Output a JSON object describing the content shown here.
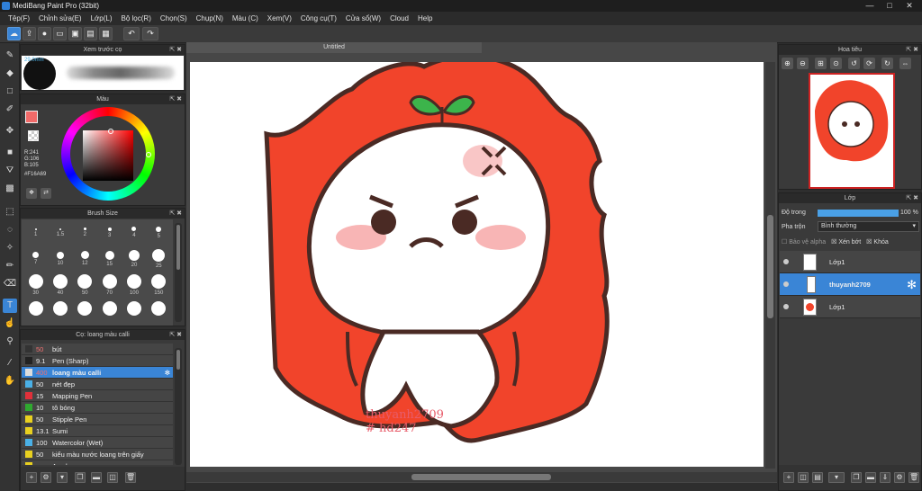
{
  "title": "MediBang Paint Pro (32bit)",
  "window_controls": {
    "minimize": "—",
    "maximize": "□",
    "close": "✕"
  },
  "menu": [
    "Tệp(F)",
    "Chỉnh sửa(E)",
    "Lớp(L)",
    "Bộ lọc(R)",
    "Chọn(S)",
    "Chụp(N)",
    "Màu (C)",
    "Xem(V)",
    "Công cụ(T)",
    "Cửa sổ(W)",
    "Cloud",
    "Help"
  ],
  "toolbar_icons": [
    "cloud-icon",
    "export-icon",
    "speech-icon",
    "comment-icon",
    "save-icon",
    "layout-icon",
    "grid-icon",
    "undo-icon",
    "redo-icon"
  ],
  "left_tools": [
    "brush-icon",
    "eraser-icon",
    "rectangle-icon",
    "pen-fill-icon",
    "move-icon",
    "fill-rect-icon",
    "bucket-icon",
    "gradient-icon",
    "select-rect-icon",
    "lasso-icon",
    "magic-wand-icon",
    "select-pen-icon",
    "select-eraser-icon",
    "text-icon",
    "hand-select-icon",
    "dropper-icon",
    "eyedropper-icon",
    "hand-icon"
  ],
  "brush_preview": {
    "title": "Xem trước cọ",
    "size_label": "29.0mm"
  },
  "color_panel": {
    "title": "Màu",
    "r": "R:241",
    "g": "G:106",
    "b": "B:105",
    "hex": "#F16A69",
    "primary_color": "#F16A69"
  },
  "brush_size": {
    "title": "Brush Size",
    "rows": [
      [
        "1",
        "1.5",
        "2",
        "3",
        "4",
        "5"
      ],
      [
        "7",
        "10",
        "12",
        "15",
        "20",
        "25"
      ],
      [
        "30",
        "40",
        "50",
        "70",
        "100",
        "150"
      ],
      [
        "",
        "",
        "",
        "",
        "",
        ""
      ]
    ]
  },
  "brush_list": {
    "title": "Cọ: loang màu calli",
    "items": [
      {
        "size": "50",
        "name": "bút",
        "color": "#333333"
      },
      {
        "size": "9.1",
        "name": "Pen (Sharp)",
        "color": "#222222"
      },
      {
        "size": "400",
        "name": "loang màu calli",
        "color": "#dddddd",
        "selected": true
      },
      {
        "size": "50",
        "name": "nét đẹp",
        "color": "#4ab0e6"
      },
      {
        "size": "15",
        "name": "Mapping Pen",
        "color": "#e0303a"
      },
      {
        "size": "10",
        "name": "tô bóng",
        "color": "#2fa82f"
      },
      {
        "size": "50",
        "name": "Stipple Pen",
        "color": "#e8d020"
      },
      {
        "size": "13.1",
        "name": "Sumi",
        "color": "#e8d020"
      },
      {
        "size": "100",
        "name": "Watercolor (Wet)",
        "color": "#4ab0e6"
      },
      {
        "size": "50",
        "name": "kiểu màu nước loang trên giấy",
        "color": "#e8d020"
      },
      {
        "size": "",
        "name": "Acryla",
        "color": "#e8d020"
      }
    ]
  },
  "canvas": {
    "tab": "Untitled",
    "watermark_line1": "thuyanh2709",
    "watermark_line2": "# hd247"
  },
  "navigator": {
    "title": "Hoa tiêu"
  },
  "layers": {
    "title": "Lớp",
    "opacity_label": "Độ trong",
    "opacity_value": "100 %",
    "opacity_fraction": 1.0,
    "blend_label": "Pha trộn",
    "blend_value": "Bình thường",
    "protect_alpha": "Bảo vệ alpha",
    "clipping": "Xén bớt",
    "lock": "Khóa",
    "items": [
      {
        "name": "Lớp1",
        "selected": false
      },
      {
        "name": "thuyanh2709",
        "selected": true
      },
      {
        "name": "Lớp1",
        "selected": false
      }
    ]
  }
}
